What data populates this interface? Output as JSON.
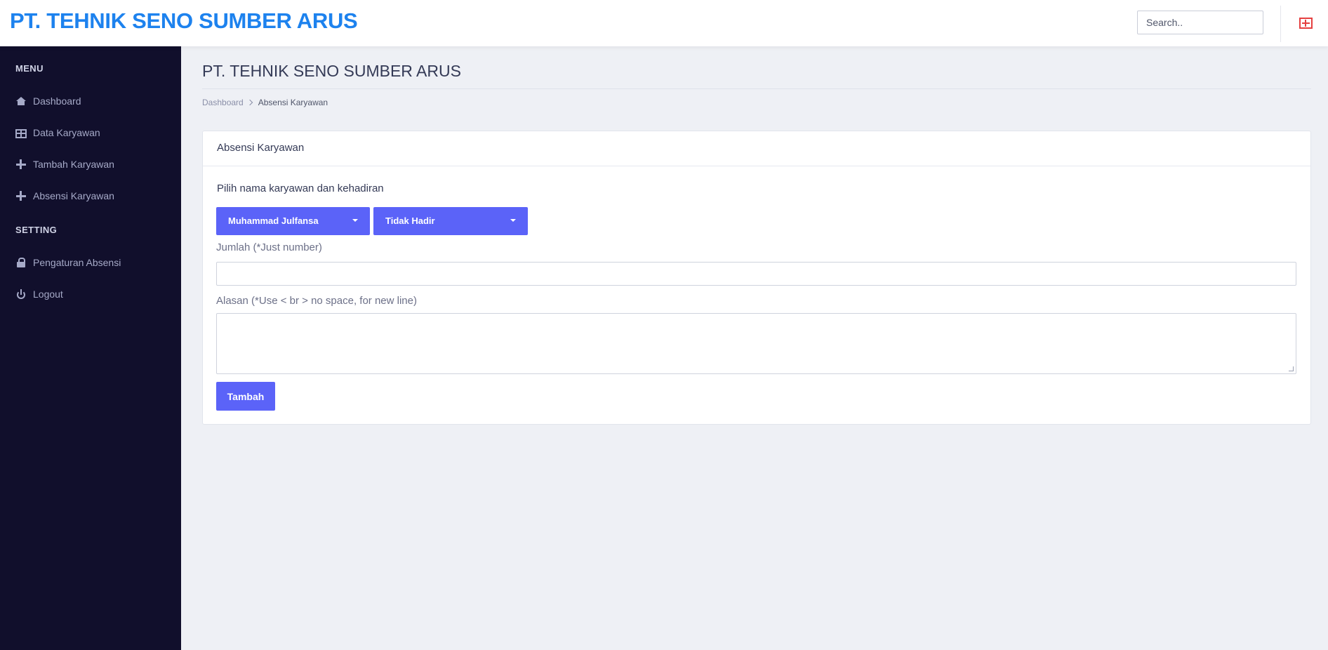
{
  "header": {
    "brand": "PT. TEHNIK SENO SUMBER ARUS",
    "search_placeholder": "Search.."
  },
  "sidebar": {
    "menu_label": "MENU",
    "menu_items": [
      {
        "label": "Dashboard",
        "icon": "home-icon"
      },
      {
        "label": "Data Karyawan",
        "icon": "table-icon"
      },
      {
        "label": "Tambah Karyawan",
        "icon": "plus-icon"
      },
      {
        "label": "Absensi Karyawan",
        "icon": "plus-icon"
      }
    ],
    "setting_label": "SETTING",
    "setting_items": [
      {
        "label": "Pengaturan Absensi",
        "icon": "lock-icon"
      },
      {
        "label": "Logout",
        "icon": "power-icon"
      }
    ]
  },
  "main": {
    "page_title": "PT. TEHNIK SENO SUMBER ARUS",
    "breadcrumb": {
      "home": "Dashboard",
      "current": "Absensi Karyawan"
    },
    "card": {
      "title": "Absensi Karyawan",
      "form_heading": "Pilih nama karyawan dan kehadiran",
      "employee_select": "Muhammad Julfansa",
      "attendance_select": "Tidak Hadir",
      "amount_label": "Jumlah (*Just number)",
      "amount_value": "",
      "reason_label": "Alasan (*Use < br > no space, for new line)",
      "reason_value": "",
      "submit_label": "Tambah"
    }
  },
  "colors": {
    "brand": "#1d82ee",
    "primary": "#5b63f8",
    "sidebar_bg": "#110f2c",
    "page_bg": "#eef0f5",
    "alert_icon": "#e54040"
  }
}
